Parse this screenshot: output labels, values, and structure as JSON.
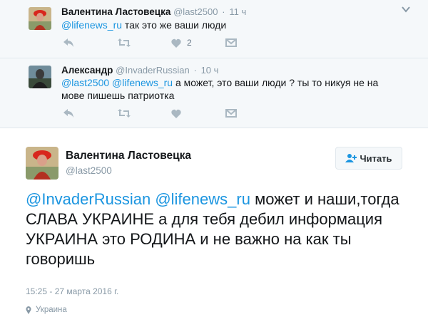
{
  "replies": [
    {
      "name": "Валентина Ластовецка",
      "handle": "@last2500",
      "time": "11 ч",
      "mentions": [
        "@lifenews_ru"
      ],
      "text": " так это же ваши люди",
      "like_count": "2"
    },
    {
      "name": "Александр",
      "handle": "@InvaderRussian",
      "time": "10 ч",
      "mentions": [
        "@last2500",
        "@lifenews_ru"
      ],
      "text": " а может, это ваши люди ? ты то никуя не на мове пишешь патриотка"
    }
  ],
  "main_tweet": {
    "name": "Валентина Ластовецка",
    "handle": "@last2500",
    "follow_label": "Читать",
    "mentions": [
      "@InvaderRussian",
      "@lifenews_ru"
    ],
    "text": " может и наши,тогда СЛАВА УКРАИНЕ а для тебя дебил информация УКРАИНА это РОДИНА и не важно на как ты говоришь",
    "date": "15:25 - 27 марта 2016 г.",
    "location": "Украина"
  },
  "colors": {
    "link": "#1b95e0",
    "muted": "#8899a6",
    "reply_bg": "#f5f8fa",
    "border": "#e1e8ed"
  },
  "icons": [
    "reply-icon",
    "retweet-icon",
    "like-icon",
    "message-icon",
    "caret-down-icon",
    "follow-icon",
    "location-pin-icon"
  ]
}
